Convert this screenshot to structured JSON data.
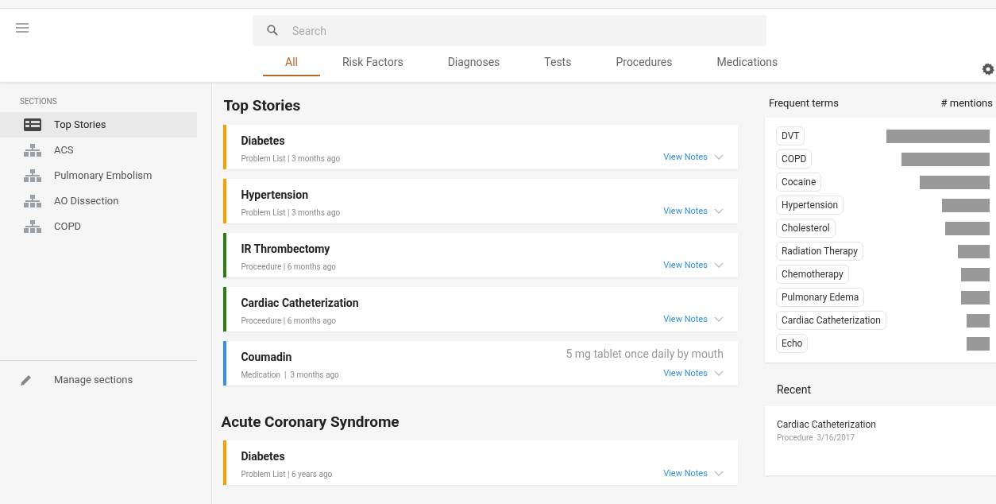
{
  "header": {
    "search": {
      "placeholder": "Search"
    },
    "tabs": [
      {
        "label": "All",
        "selected": true
      },
      {
        "label": "Risk Factors",
        "selected": false
      },
      {
        "label": "Diagnoses",
        "selected": false
      },
      {
        "label": "Tests",
        "selected": false
      },
      {
        "label": "Procedures",
        "selected": false
      },
      {
        "label": "Medications",
        "selected": false
      }
    ]
  },
  "sidebar": {
    "heading": "SECTIONS",
    "items": [
      {
        "label": "Top Stories",
        "kind": "list",
        "selected": true
      },
      {
        "label": "ACS",
        "kind": "tree",
        "selected": false
      },
      {
        "label": "Pulmonary Embolism",
        "kind": "tree",
        "selected": false
      },
      {
        "label": "AO Dissection",
        "kind": "tree",
        "selected": false
      },
      {
        "label": "COPD",
        "kind": "tree",
        "selected": false
      }
    ],
    "manage": "Manage sections"
  },
  "sections": [
    {
      "title": "Top Stories",
      "stories": [
        {
          "title": "Diabetes",
          "meta": "Problem List | 3 months ago",
          "color": "#f5a000",
          "link": "View Notes"
        },
        {
          "title": "Hypertension",
          "meta": "Problem List | 3 months ago",
          "color": "#f5a000",
          "link": "View Notes"
        },
        {
          "title": "IR Thrombectomy",
          "meta": "Proceedure | 6 months ago",
          "color": "#2e7d12",
          "link": "View Notes"
        },
        {
          "title": "Cardiac Catheterization",
          "meta": "Proceedure | 6 months ago",
          "color": "#2e7d12",
          "link": "View Notes"
        },
        {
          "title": "Coumadin",
          "meta": "Medication  |  3 months ago",
          "detail": "5 mg tablet once daily by mouth",
          "color": "#3a8ee6",
          "link": "View Notes"
        }
      ]
    },
    {
      "title": "Acute Coronary Syndrome",
      "stories": [
        {
          "title": "Diabetes",
          "meta": "Problem List | 6 years ago",
          "color": "#f5a000",
          "link": "View Notes"
        }
      ]
    }
  ],
  "frequent_terms": {
    "title": "Frequent terms",
    "column": "# mentions",
    "terms": [
      {
        "label": "DVT"
      },
      {
        "label": "COPD"
      },
      {
        "label": "Cocaine"
      },
      {
        "label": "Hypertension"
      },
      {
        "label": "Cholesterol"
      },
      {
        "label": "Radiation Therapy"
      },
      {
        "label": "Chemotherapy"
      },
      {
        "label": "Pulmonary Edema"
      },
      {
        "label": "Cardiac Catheterization"
      },
      {
        "label": "Echo"
      }
    ]
  },
  "recent": {
    "title": "Recent",
    "items": [
      {
        "title": "Cardiac Catheterization",
        "meta": "Procedure  3/16/2017"
      }
    ]
  }
}
